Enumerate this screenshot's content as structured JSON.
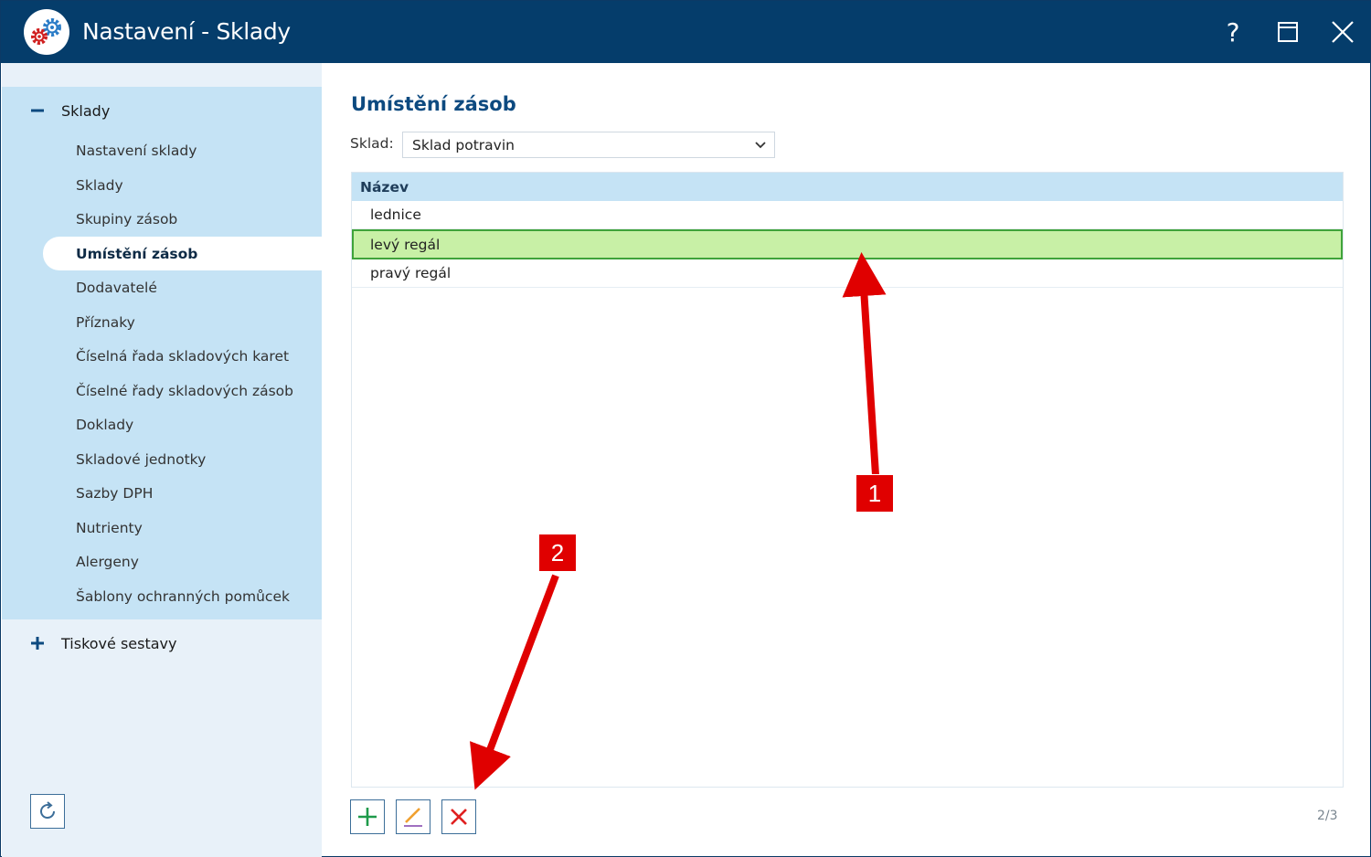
{
  "window": {
    "title": "Nastavení - Sklady",
    "help_glyph": "?"
  },
  "sidebar": {
    "sections": [
      {
        "label": "Sklady",
        "expanded": true
      },
      {
        "label": "Tiskové sestavy",
        "expanded": false
      }
    ],
    "items": [
      {
        "label": "Nastavení sklady"
      },
      {
        "label": "Sklady"
      },
      {
        "label": "Skupiny zásob"
      },
      {
        "label": "Umístění zásob",
        "active": true
      },
      {
        "label": "Dodavatelé"
      },
      {
        "label": "Příznaky"
      },
      {
        "label": "Číselná řada skladových karet"
      },
      {
        "label": "Číselné řady skladových zásob"
      },
      {
        "label": "Doklady"
      },
      {
        "label": "Skladové jednotky"
      },
      {
        "label": "Sazby DPH"
      },
      {
        "label": "Nutrienty"
      },
      {
        "label": "Alergeny"
      },
      {
        "label": "Šablony ochranných pomůcek"
      }
    ]
  },
  "main": {
    "title": "Umístění zásob",
    "sklad_label": "Sklad:",
    "sklad_value": "Sklad potravin",
    "grid": {
      "header": "Název",
      "rows": [
        {
          "label": "lednice"
        },
        {
          "label": "levý regál",
          "selected": true
        },
        {
          "label": "pravý regál"
        }
      ]
    },
    "counter": "2/3"
  },
  "annotations": {
    "badge1": "1",
    "badge2": "2",
    "color": "#e00000"
  },
  "colors": {
    "titlebar": "#053d6b",
    "sidebar_group": "#c5e3f5",
    "selected_row": "#c8f0a6",
    "selected_border": "#3fa33a",
    "accent_title": "#0d4a80"
  }
}
